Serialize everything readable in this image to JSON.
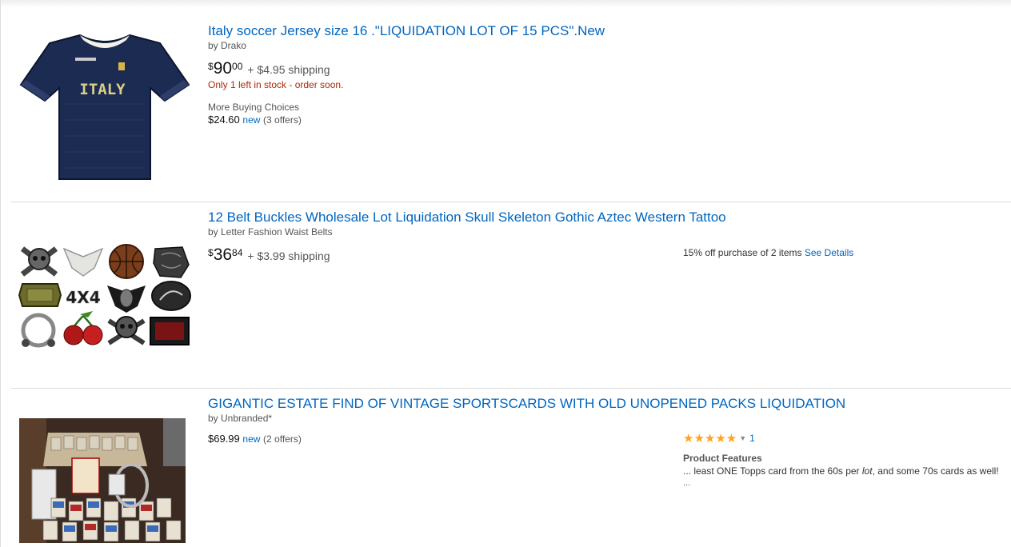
{
  "results": [
    {
      "title": "Italy soccer Jersey size 16 .\"LIQUIDATION LOT OF 15 PCS\".New",
      "byline": "by Drako",
      "price": {
        "symbol": "$",
        "whole": "90",
        "fraction": "00"
      },
      "shipping": "+ $4.95 shipping",
      "stock_note": "Only 1 left in stock - order soon.",
      "more_buying_choices": "More Buying Choices",
      "offer": {
        "price": "$24.60",
        "condition": "new",
        "count": "(3 offers)"
      },
      "thumbnail": {
        "jersey_text": "ITALY"
      }
    },
    {
      "title": "12 Belt Buckles Wholesale Lot Liquidation Skull Skeleton Gothic Aztec Western Tattoo",
      "byline": "by Letter Fashion Waist Belts",
      "price": {
        "symbol": "$",
        "whole": "36",
        "fraction": "84"
      },
      "shipping": "+ $3.99 shipping",
      "promo": {
        "text": "15% off purchase of 2 items",
        "link": "See Details"
      },
      "thumbnail": {
        "buckle_text": "4X4"
      }
    },
    {
      "title": "GIGANTIC ESTATE FIND OF VINTAGE SPORTSCARDS WITH OLD UNOPENED PACKS LIQUIDATION",
      "byline": "by Unbranded*",
      "offer": {
        "price": "$69.99",
        "condition": "new",
        "count": "(2 offers)"
      },
      "rating": {
        "stars": "★★★★★",
        "value": 5,
        "count": "1"
      },
      "features": {
        "title": "Product Features",
        "text_before": "... least ONE Topps card from the 60s per ",
        "text_italic": "lot",
        "text_after": ", and some 70s cards as well!",
        "more": "..."
      }
    }
  ],
  "colors": {
    "link": "#0066c0",
    "stock_red": "#b12704",
    "star": "#ffa41c",
    "divider": "#dddddd"
  }
}
